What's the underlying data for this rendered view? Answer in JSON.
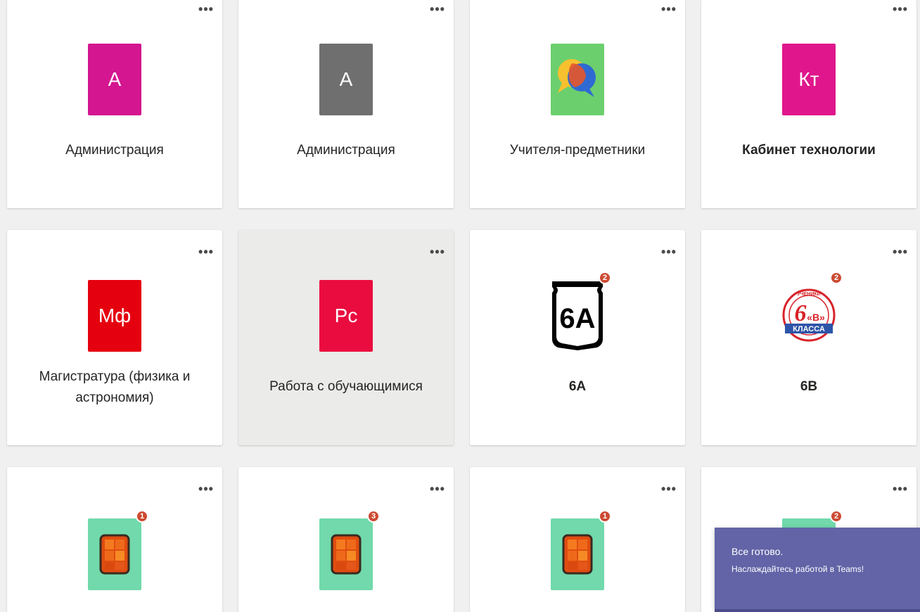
{
  "more_label": "•••",
  "teams": [
    {
      "name": "Администрация",
      "initials": "А",
      "color": "#d41690",
      "icon": "initials"
    },
    {
      "name": "Администрация",
      "initials": "А",
      "color": "#6f6f6f",
      "icon": "initials"
    },
    {
      "name": "Учителя-предметники",
      "initials": "",
      "color": "#6ccf6e",
      "icon": "chat-bubbles-icon"
    },
    {
      "name": "Кабинет технологии",
      "initials": "Кт",
      "color": "#e0178c",
      "icon": "initials",
      "bold": true
    },
    {
      "name": "Магистратура (физика и астрономия)",
      "initials": "Мф",
      "color": "#e5000f",
      "icon": "initials"
    },
    {
      "name": "Работа с обучающимися",
      "initials": "Рс",
      "color": "#ea0c3f",
      "icon": "initials"
    },
    {
      "name": "6А",
      "initials": "",
      "icon": "shield-6a-icon",
      "badge": "2",
      "bold": true,
      "shield_text": "6A"
    },
    {
      "name": "6В",
      "initials": "",
      "icon": "badge-6v-icon",
      "badge": "2",
      "bold": true,
      "emblem": {
        "top": "УЧЕНИКИ",
        "number": "6",
        "letter": "«В»",
        "bottom": "КЛАССА"
      }
    },
    {
      "name": "",
      "initials": "",
      "color": "#71d9ab",
      "icon": "orange-square-icon",
      "badge": "1"
    },
    {
      "name": "",
      "initials": "",
      "color": "#71d9ab",
      "icon": "orange-square-icon",
      "badge": "3"
    },
    {
      "name": "",
      "initials": "",
      "color": "#71d9ab",
      "icon": "orange-square-icon",
      "badge": "1"
    },
    {
      "name": "",
      "initials": "",
      "color": "#71d9ab",
      "icon": "orange-square-icon",
      "badge": "2"
    }
  ],
  "toast": {
    "title": "Все готово.",
    "body": "Наслаждайтесь работой в Teams!",
    "color": "#6264a7"
  }
}
